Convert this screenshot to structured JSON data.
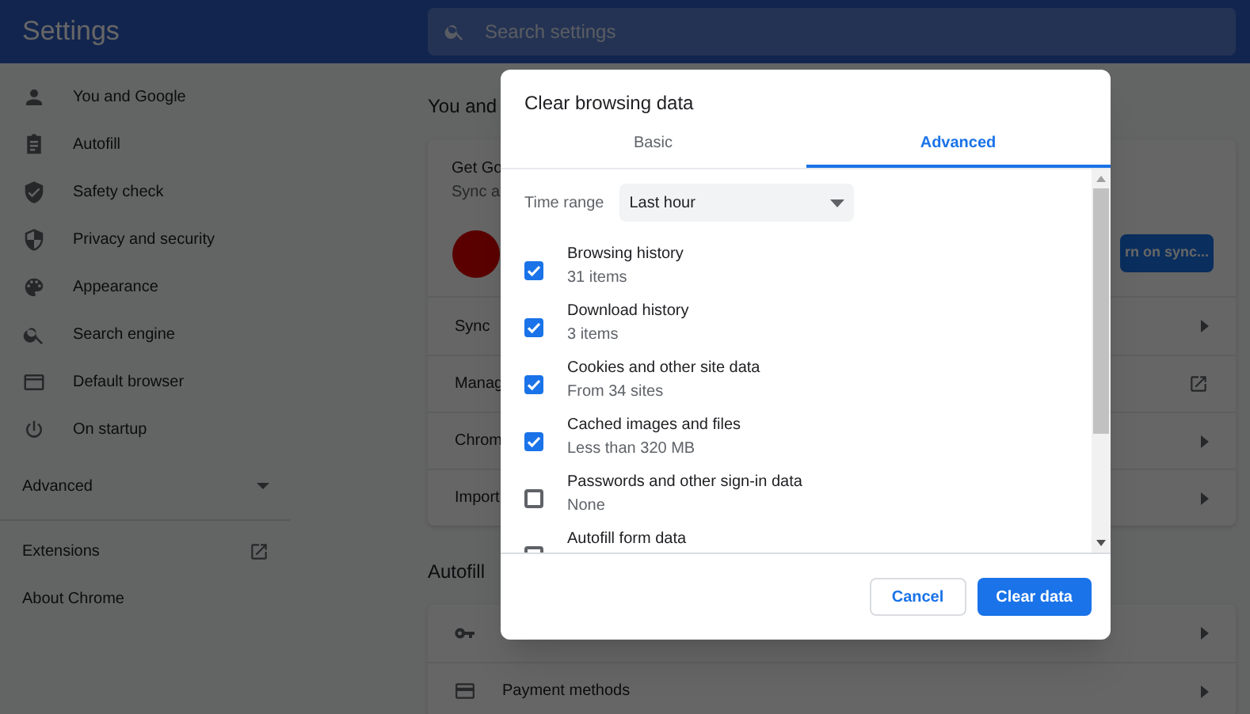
{
  "header": {
    "title": "Settings",
    "search": {
      "placeholder": "Search settings"
    }
  },
  "sidebar": {
    "items": [
      {
        "label": "You and Google"
      },
      {
        "label": "Autofill"
      },
      {
        "label": "Safety check"
      },
      {
        "label": "Privacy and security"
      },
      {
        "label": "Appearance"
      },
      {
        "label": "Search engine"
      },
      {
        "label": "Default browser"
      },
      {
        "label": "On startup"
      }
    ],
    "advanced": {
      "label": "Advanced",
      "expanded": false
    },
    "links": [
      {
        "label": "Extensions",
        "external": true
      },
      {
        "label": "About Chrome",
        "external": false
      }
    ]
  },
  "main": {
    "sections": [
      {
        "heading": "You and",
        "card": {
          "title": "Get Go",
          "subtitle": "Sync a",
          "button": "rn on sync...",
          "rows": [
            {
              "label": "Sync",
              "kind": "arrow"
            },
            {
              "label": "Manag",
              "kind": "external"
            },
            {
              "label": "Chrom",
              "kind": "arrow"
            },
            {
              "label": "Import",
              "kind": "arrow"
            }
          ]
        }
      },
      {
        "heading": "Autofill",
        "card": {
          "rows": [
            {
              "kind": "arrow"
            },
            {
              "label": "Payment methods",
              "kind": "arrow"
            }
          ]
        }
      }
    ]
  },
  "dialog": {
    "title": "Clear browsing data",
    "tabs": [
      {
        "label": "Basic",
        "selected": false
      },
      {
        "label": "Advanced",
        "selected": true
      }
    ],
    "time_range": {
      "label": "Time range",
      "value": "Last hour"
    },
    "items": [
      {
        "label": "Browsing history",
        "detail": "31 items",
        "checked": true
      },
      {
        "label": "Download history",
        "detail": "3 items",
        "checked": true
      },
      {
        "label": "Cookies and other site data",
        "detail": "From 34 sites",
        "checked": true
      },
      {
        "label": "Cached images and files",
        "detail": "Less than 320 MB",
        "checked": true
      },
      {
        "label": "Passwords and other sign-in data",
        "detail": "None",
        "checked": false
      },
      {
        "label": "Autofill form data",
        "checked": false
      }
    ],
    "buttons": {
      "cancel": "Cancel",
      "confirm": "Clear data"
    }
  }
}
